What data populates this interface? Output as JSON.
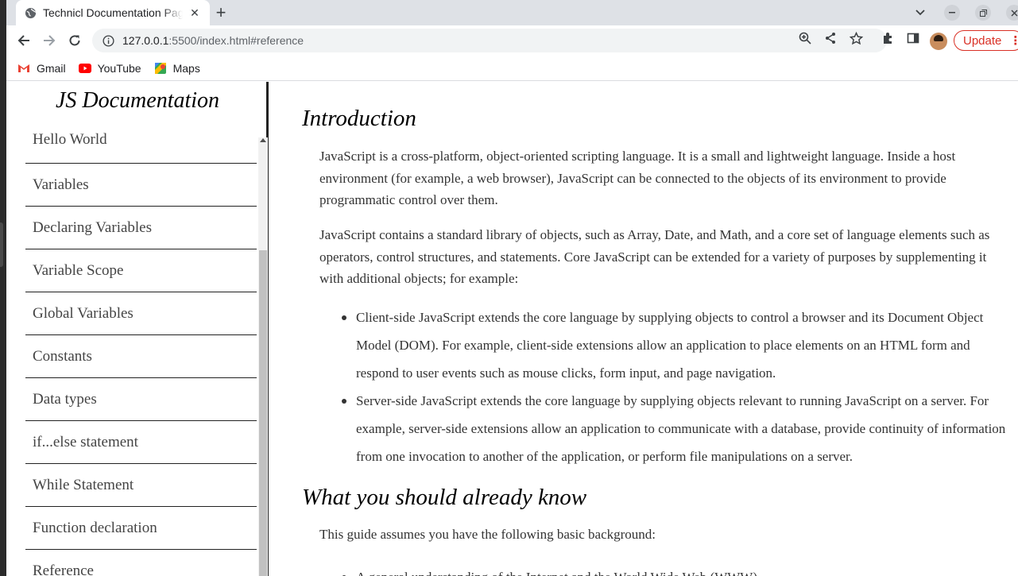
{
  "browser": {
    "tab_title": "Technicl Documentation Pag",
    "tab_close": "✕",
    "new_tab": "+",
    "url_host": "127.0.0.1",
    "url_rest": ":5500/index.html#reference",
    "update_label": "Update",
    "bookmarks": [
      {
        "label": "Gmail",
        "icon": "gmail-icon"
      },
      {
        "label": "YouTube",
        "icon": "youtube-icon"
      },
      {
        "label": "Maps",
        "icon": "maps-icon"
      }
    ],
    "accent_update": "#d93025"
  },
  "nav": {
    "title": "JS Documentation",
    "items": [
      "Hello World",
      "Variables",
      "Declaring Variables",
      "Variable Scope",
      "Global Variables",
      "Constants",
      "Data types",
      "if...else statement",
      "While Statement",
      "Function declaration",
      "Reference"
    ]
  },
  "main": {
    "intro_title": "Introduction",
    "intro_p1": "JavaScript is a cross-platform, object-oriented scripting language. It is a small and lightweight language. Inside a host environment (for example, a web browser), JavaScript can be connected to the objects of its environment to provide programmatic control over them.",
    "intro_p2": "JavaScript contains a standard library of objects, such as Array, Date, and Math, and a core set of language elements such as operators, control structures, and statements. Core JavaScript can be extended for a variety of purposes by supplementing it with additional objects; for example:",
    "intro_list": [
      "Client-side JavaScript extends the core language by supplying objects to control a browser and its Document Object Model (DOM). For example, client-side extensions allow an application to place elements on an HTML form and respond to user events such as mouse clicks, form input, and page navigation.",
      "Server-side JavaScript extends the core language by supplying objects relevant to running JavaScript on a server. For example, server-side extensions allow an application to communicate with a database, provide continuity of information from one invocation to another of the application, or perform file manipulations on a server."
    ],
    "know_title": "What you should already know",
    "know_p": "This guide assumes you have the following basic background:",
    "know_list": [
      "A general understanding of the Internet and the World Wide Web (WWW)."
    ]
  }
}
